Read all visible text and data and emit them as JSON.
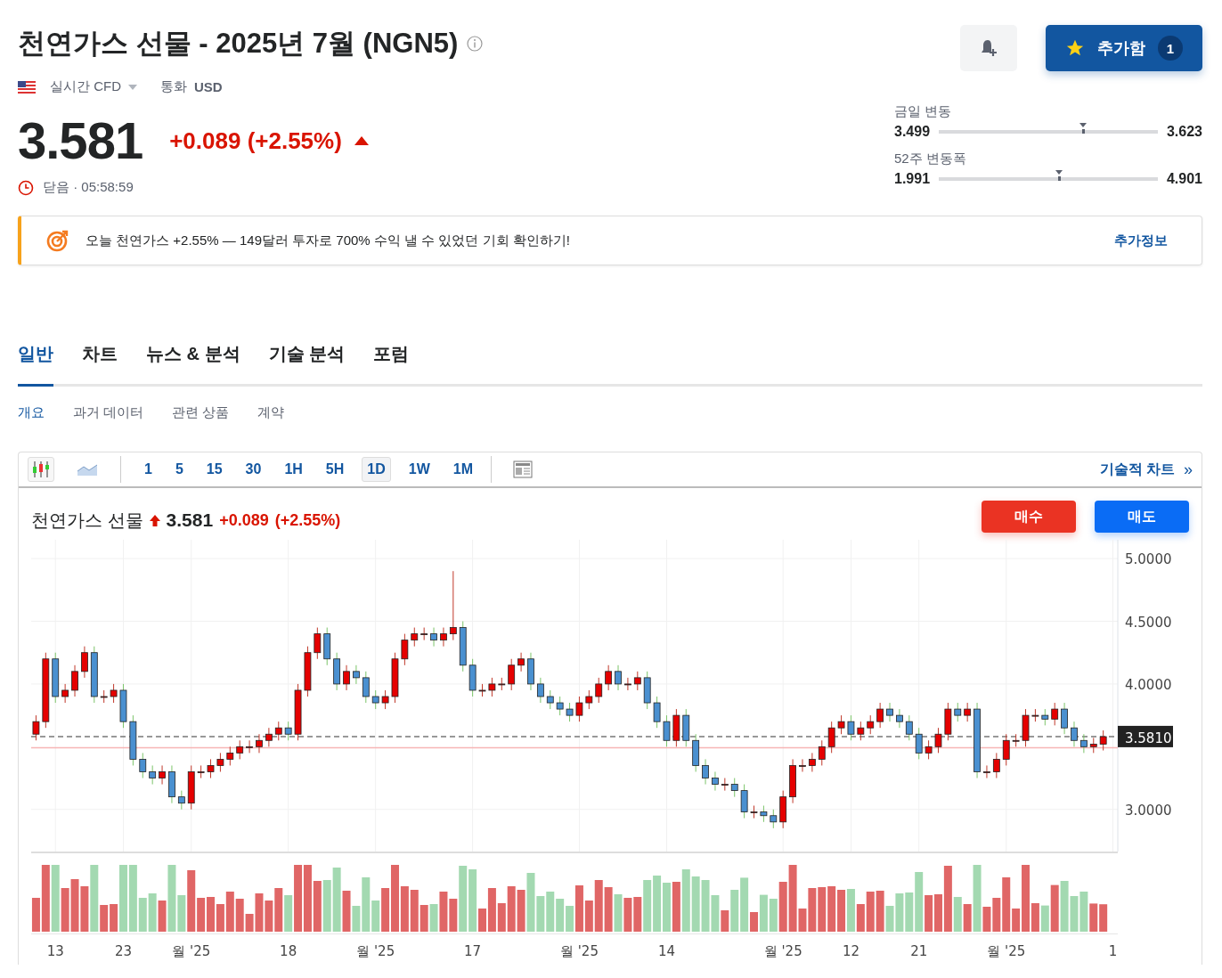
{
  "header": {
    "title": "천연가스 선물 - 2025년 7월 (NGN5)",
    "market": "실시간 CFD",
    "currency_label": "통화",
    "currency": "USD",
    "watch_button": {
      "label": "추가함",
      "count": "1"
    }
  },
  "quote": {
    "price": "3.581",
    "change": "+0.089 (+2.55%)",
    "status": "닫음 · 05:58:59"
  },
  "ranges": [
    {
      "label": "금일 변동",
      "low": "3.499",
      "high": "3.623",
      "level": 0.66
    },
    {
      "label": "52주 변동폭",
      "low": "1.991",
      "high": "4.901",
      "level": 0.55
    }
  ],
  "banner": {
    "text": "오늘 천연가스 +2.55% — 149달러 투자로 700% 수익 낼 수 있었던 기회 확인하기!",
    "link": "추가정보"
  },
  "tabs": [
    {
      "label": "일반",
      "selected": true
    },
    {
      "label": "차트",
      "selected": false
    },
    {
      "label": "뉴스 & 분석",
      "selected": false
    },
    {
      "label": "기술 분석",
      "selected": false
    },
    {
      "label": "포럼",
      "selected": false
    }
  ],
  "subtabs": [
    {
      "label": "개요",
      "selected": true
    },
    {
      "label": "과거 데이터",
      "selected": false
    },
    {
      "label": "관련 상품",
      "selected": false
    },
    {
      "label": "계약",
      "selected": false
    }
  ],
  "toolbar": {
    "chart_types": [
      {
        "kind": "candle",
        "selected": true
      },
      {
        "kind": "area",
        "selected": false
      }
    ],
    "intervals": [
      {
        "label": "1",
        "selected": false
      },
      {
        "label": "5",
        "selected": false
      },
      {
        "label": "15",
        "selected": false
      },
      {
        "label": "30",
        "selected": false
      },
      {
        "label": "1H",
        "selected": false
      },
      {
        "label": "5H",
        "selected": false
      },
      {
        "label": "1D",
        "selected": true
      },
      {
        "label": "1W",
        "selected": false
      },
      {
        "label": "1M",
        "selected": false
      }
    ],
    "link": "기술적 차트",
    "link_arrow": "»"
  },
  "chart": {
    "name": "천연가스 선물",
    "price": "3.581",
    "change": "+0.089",
    "percent": "(+2.55%)",
    "buy": "매수",
    "sell": "매도",
    "x_labels": [
      "13",
      "23",
      "월 '25",
      "18",
      "월 '25",
      "17",
      "월 '25",
      "14",
      "월 '25",
      "12",
      "21",
      "월 '25",
      "1"
    ],
    "chart_data": {
      "type": "candlestick",
      "grid": true,
      "ylim": [
        2.65,
        5.15
      ],
      "ref_lines": [
        {
          "axis": "y",
          "value": 3.581,
          "label": "3.5810"
        },
        {
          "axis": "y",
          "value": 3.492
        }
      ],
      "yticks": [
        {
          "value": 5,
          "label": "5.0000"
        },
        {
          "value": 4.5,
          "label": "4.5000"
        },
        {
          "value": 4,
          "label": "4.0000"
        },
        {
          "value": 3,
          "label": "3.0000"
        }
      ],
      "ohlc": [
        [
          3.6,
          3.75,
          3.55,
          3.7
        ],
        [
          3.7,
          4.25,
          3.65,
          4.2
        ],
        [
          4.2,
          4.25,
          3.85,
          3.9
        ],
        [
          3.9,
          4.0,
          3.85,
          3.95
        ],
        [
          3.95,
          4.15,
          3.9,
          4.1
        ],
        [
          4.1,
          4.3,
          4.05,
          4.25
        ],
        [
          4.25,
          4.3,
          3.85,
          3.9
        ],
        [
          3.9,
          3.95,
          3.85,
          3.9
        ],
        [
          3.9,
          4.0,
          3.85,
          3.95
        ],
        [
          3.95,
          4.0,
          3.65,
          3.7
        ],
        [
          3.7,
          3.75,
          3.35,
          3.4
        ],
        [
          3.4,
          3.45,
          3.25,
          3.3
        ],
        [
          3.3,
          3.35,
          3.2,
          3.25
        ],
        [
          3.25,
          3.35,
          3.2,
          3.3
        ],
        [
          3.3,
          3.35,
          3.05,
          3.1
        ],
        [
          3.1,
          3.15,
          3.0,
          3.05
        ],
        [
          3.05,
          3.35,
          3.0,
          3.3
        ],
        [
          3.3,
          3.35,
          3.25,
          3.3
        ],
        [
          3.3,
          3.4,
          3.25,
          3.35
        ],
        [
          3.35,
          3.45,
          3.3,
          3.4
        ],
        [
          3.4,
          3.5,
          3.35,
          3.45
        ],
        [
          3.45,
          3.55,
          3.4,
          3.5
        ],
        [
          3.5,
          3.55,
          3.45,
          3.5
        ],
        [
          3.5,
          3.6,
          3.45,
          3.55
        ],
        [
          3.55,
          3.65,
          3.5,
          3.6
        ],
        [
          3.6,
          3.7,
          3.55,
          3.65
        ],
        [
          3.65,
          3.7,
          3.55,
          3.6
        ],
        [
          3.6,
          4.0,
          3.55,
          3.95
        ],
        [
          3.95,
          4.3,
          3.9,
          4.25
        ],
        [
          4.25,
          4.45,
          4.2,
          4.4
        ],
        [
          4.4,
          4.45,
          4.15,
          4.2
        ],
        [
          4.2,
          4.25,
          3.95,
          4.0
        ],
        [
          4.0,
          4.15,
          3.95,
          4.1
        ],
        [
          4.1,
          4.15,
          4.0,
          4.05
        ],
        [
          4.05,
          4.1,
          3.85,
          3.9
        ],
        [
          3.9,
          3.95,
          3.8,
          3.85
        ],
        [
          3.85,
          3.95,
          3.8,
          3.9
        ],
        [
          3.9,
          4.25,
          3.85,
          4.2
        ],
        [
          4.2,
          4.4,
          4.15,
          4.35
        ],
        [
          4.35,
          4.45,
          4.3,
          4.4
        ],
        [
          4.4,
          4.45,
          4.35,
          4.4
        ],
        [
          4.4,
          4.45,
          4.3,
          4.35
        ],
        [
          4.35,
          4.45,
          4.3,
          4.4
        ],
        [
          4.4,
          4.9,
          4.35,
          4.45
        ],
        [
          4.45,
          4.5,
          4.1,
          4.15
        ],
        [
          4.15,
          4.2,
          3.9,
          3.95
        ],
        [
          3.95,
          4.0,
          3.9,
          3.95
        ],
        [
          3.95,
          4.05,
          3.9,
          4.0
        ],
        [
          4.0,
          4.05,
          3.95,
          4.0
        ],
        [
          4.0,
          4.2,
          3.95,
          4.15
        ],
        [
          4.15,
          4.25,
          4.1,
          4.2
        ],
        [
          4.2,
          4.25,
          3.95,
          4.0
        ],
        [
          4.0,
          4.05,
          3.85,
          3.9
        ],
        [
          3.9,
          3.95,
          3.8,
          3.85
        ],
        [
          3.85,
          3.9,
          3.75,
          3.8
        ],
        [
          3.8,
          3.85,
          3.7,
          3.75
        ],
        [
          3.75,
          3.9,
          3.7,
          3.85
        ],
        [
          3.85,
          3.95,
          3.8,
          3.9
        ],
        [
          3.9,
          4.05,
          3.85,
          4.0
        ],
        [
          4.0,
          4.15,
          3.95,
          4.1
        ],
        [
          4.1,
          4.15,
          3.95,
          4.0
        ],
        [
          4.0,
          4.05,
          3.95,
          4.0
        ],
        [
          4.0,
          4.1,
          3.95,
          4.05
        ],
        [
          4.05,
          4.1,
          3.8,
          3.85
        ],
        [
          3.85,
          3.9,
          3.65,
          3.7
        ],
        [
          3.7,
          3.75,
          3.5,
          3.55
        ],
        [
          3.55,
          3.8,
          3.5,
          3.75
        ],
        [
          3.75,
          3.8,
          3.5,
          3.55
        ],
        [
          3.55,
          3.6,
          3.3,
          3.35
        ],
        [
          3.35,
          3.4,
          3.2,
          3.25
        ],
        [
          3.25,
          3.3,
          3.15,
          3.2
        ],
        [
          3.2,
          3.25,
          3.15,
          3.2
        ],
        [
          3.2,
          3.25,
          3.1,
          3.15
        ],
        [
          3.15,
          3.2,
          2.93,
          2.98
        ],
        [
          2.98,
          3.03,
          2.93,
          2.98
        ],
        [
          2.98,
          3.03,
          2.9,
          2.95
        ],
        [
          2.95,
          3.0,
          2.85,
          2.9
        ],
        [
          2.9,
          3.15,
          2.85,
          3.1
        ],
        [
          3.1,
          3.4,
          3.05,
          3.35
        ],
        [
          3.35,
          3.4,
          3.3,
          3.35
        ],
        [
          3.35,
          3.45,
          3.3,
          3.4
        ],
        [
          3.4,
          3.55,
          3.35,
          3.5
        ],
        [
          3.5,
          3.7,
          3.45,
          3.65
        ],
        [
          3.65,
          3.75,
          3.6,
          3.7
        ],
        [
          3.7,
          3.75,
          3.55,
          3.6
        ],
        [
          3.6,
          3.7,
          3.55,
          3.65
        ],
        [
          3.65,
          3.75,
          3.6,
          3.7
        ],
        [
          3.7,
          3.85,
          3.65,
          3.8
        ],
        [
          3.8,
          3.85,
          3.7,
          3.75
        ],
        [
          3.75,
          3.8,
          3.65,
          3.7
        ],
        [
          3.7,
          3.75,
          3.55,
          3.6
        ],
        [
          3.6,
          3.65,
          3.4,
          3.45
        ],
        [
          3.45,
          3.55,
          3.4,
          3.5
        ],
        [
          3.5,
          3.65,
          3.45,
          3.6
        ],
        [
          3.6,
          3.85,
          3.55,
          3.8
        ],
        [
          3.8,
          3.85,
          3.7,
          3.75
        ],
        [
          3.75,
          3.85,
          3.7,
          3.8
        ],
        [
          3.8,
          3.85,
          3.25,
          3.3
        ],
        [
          3.3,
          3.35,
          3.25,
          3.3
        ],
        [
          3.3,
          3.45,
          3.25,
          3.4
        ],
        [
          3.4,
          3.6,
          3.35,
          3.55
        ],
        [
          3.55,
          3.6,
          3.5,
          3.55
        ],
        [
          3.55,
          3.8,
          3.5,
          3.75
        ],
        [
          3.75,
          3.8,
          3.7,
          3.75
        ],
        [
          3.75,
          3.8,
          3.67,
          3.72
        ],
        [
          3.72,
          3.85,
          3.67,
          3.8
        ],
        [
          3.8,
          3.85,
          3.6,
          3.65
        ],
        [
          3.65,
          3.7,
          3.5,
          3.55
        ],
        [
          3.55,
          3.6,
          3.45,
          3.5
        ],
        [
          3.5,
          3.57,
          3.45,
          3.52
        ],
        [
          3.52,
          3.63,
          3.47,
          3.58
        ]
      ]
    }
  }
}
